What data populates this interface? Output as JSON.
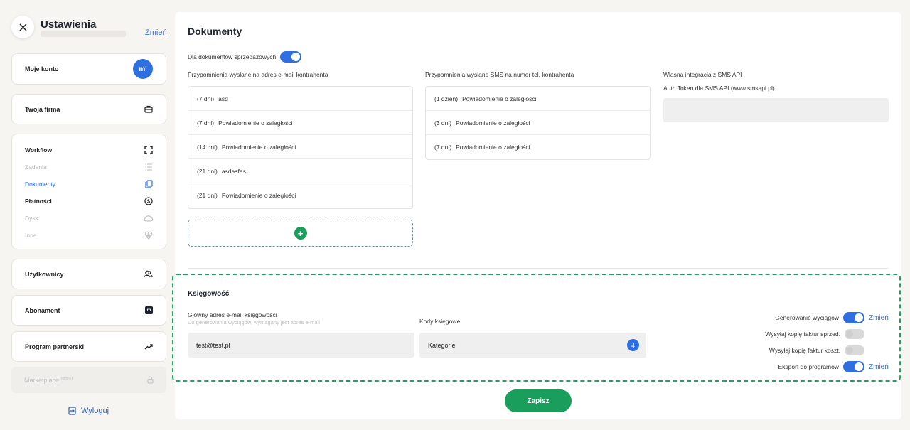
{
  "sidebar": {
    "title": "Ustawienia",
    "change_label": "Zmień",
    "items_top": [
      {
        "label": "Moje konto",
        "badge": "m'"
      },
      {
        "label": "Twoja firma"
      }
    ],
    "group": [
      {
        "label": "Workflow",
        "icon": "expand-icon",
        "state": "bold"
      },
      {
        "label": "Zadania",
        "icon": "list-icon",
        "state": "muted"
      },
      {
        "label": "Dokumenty",
        "icon": "documents-icon",
        "state": "active"
      },
      {
        "label": "Płatności",
        "icon": "dollar-icon",
        "state": "bold"
      },
      {
        "label": "Dysk",
        "icon": "cloud-icon",
        "state": "muted"
      },
      {
        "label": "Inne",
        "icon": "shapes-icon",
        "state": "muted"
      }
    ],
    "items_bottom": [
      {
        "label": "Użytkownicy"
      },
      {
        "label": "Abonament"
      },
      {
        "label": "Program partnerski"
      },
      {
        "label": "Marketplace",
        "tag": "(offline)"
      }
    ],
    "logout_label": "Wyloguj"
  },
  "main": {
    "title": "Dokumenty",
    "sales_toggle_label": "Dla dokumentów sprzedażowych",
    "email_reminders_title": "Przypomnienia wysłane na adres e-mail kontrahenta",
    "email_reminders": [
      {
        "days": "(7 dni)",
        "text": "asd"
      },
      {
        "days": "(7 dni)",
        "text": "Powiadomienie o zaległości"
      },
      {
        "days": "(14 dni)",
        "text": "Powiadomienie o zaległości"
      },
      {
        "days": "(21 dni)",
        "text": "asdasfas"
      },
      {
        "days": "(21 dni)",
        "text": "Powiadomienie o zaległości"
      }
    ],
    "add_label": "+",
    "sms_reminders_title": "Przypomnienia wysłane SMS na numer tel. kontrahenta",
    "sms_reminders": [
      {
        "days": "(1 dzień)",
        "text": "Powiadomienie o zaległości"
      },
      {
        "days": "(3 dni)",
        "text": "Powiadomienie o zaległości"
      },
      {
        "days": "(7 dni)",
        "text": "Powiadomienie o zaległości"
      }
    ],
    "sms_api_title": "Własna integracja z SMS API",
    "sms_token_label": "Auth Token dla SMS API (www.smsapi.pl)",
    "sms_token_value": ""
  },
  "accounting": {
    "title": "Księgowość",
    "email_label": "Główny adres e-mail księgowości",
    "email_hint": "Do generowania wyciągów, wymagany jest adres e-mail",
    "email_value": "test@test.pl",
    "codes_label": "Kody księgowe",
    "codes_value": "Kategorie",
    "codes_count": "4",
    "options": [
      {
        "label": "Generowanie wyciągów",
        "on": true,
        "change": "Zmień"
      },
      {
        "label": "Wysyłaj kopię faktur sprzed.",
        "on": false,
        "change": ""
      },
      {
        "label": "Wysyłaj kopię faktur koszt.",
        "on": false,
        "change": ""
      },
      {
        "label": "Eksport do programów",
        "on": true,
        "change": "Zmień"
      }
    ]
  },
  "save_label": "Zapisz",
  "colors": {
    "accent": "#2f6fe0",
    "green": "#1a9e5c",
    "background": "#f7f5f2"
  }
}
